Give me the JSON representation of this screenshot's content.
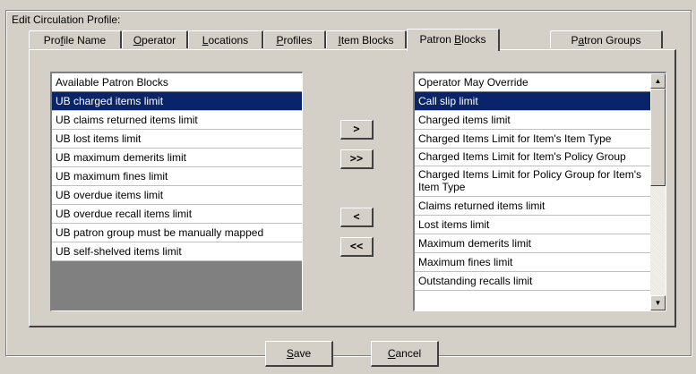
{
  "group_title": "Edit  Circulation Profile:",
  "tabs": [
    {
      "label_pre": "Pro",
      "label_u": "f",
      "label_post": "ile Name",
      "active": false
    },
    {
      "label_pre": "",
      "label_u": "O",
      "label_post": "perator",
      "active": false
    },
    {
      "label_pre": "",
      "label_u": "L",
      "label_post": "ocations",
      "active": false
    },
    {
      "label_pre": "",
      "label_u": "P",
      "label_post": "rofiles",
      "active": false
    },
    {
      "label_pre": "",
      "label_u": "I",
      "label_post": "tem Blocks",
      "active": false
    },
    {
      "label_pre": "Patron ",
      "label_u": "B",
      "label_post": "locks",
      "active": true
    },
    {
      "label_pre": "P",
      "label_u": "a",
      "label_post": "tron Groups",
      "active": false
    }
  ],
  "available_list": {
    "header": "Available Patron Blocks",
    "items": [
      "UB charged items limit",
      "UB claims returned items limit",
      "UB lost items limit",
      "UB maximum demerits limit",
      "UB maximum fines limit",
      "UB overdue items limit",
      "UB overdue recall items limit",
      "UB patron group must be manually mapped",
      "UB self-shelved items limit"
    ],
    "selected_index": 0
  },
  "override_list": {
    "header": "Operator May Override",
    "items": [
      "Call slip limit",
      "Charged items limit",
      "Charged Items Limit for Item's Item Type",
      "Charged Items Limit for Item's Policy Group",
      "Charged Items Limit for Policy Group for Item's Item Type",
      "Claims returned items limit",
      "Lost items limit",
      "Maximum demerits limit",
      "Maximum fines limit",
      "Outstanding recalls limit"
    ],
    "selected_index": 0
  },
  "transfer_buttons": {
    "add_one": ">",
    "add_all": ">>",
    "remove_one": "<",
    "remove_all": "<<"
  },
  "scrollbar": {
    "up_icon": "▲",
    "down_icon": "▼"
  },
  "footer": {
    "save_u": "S",
    "save_rest": "ave",
    "cancel_u": "C",
    "cancel_rest": "ancel"
  }
}
